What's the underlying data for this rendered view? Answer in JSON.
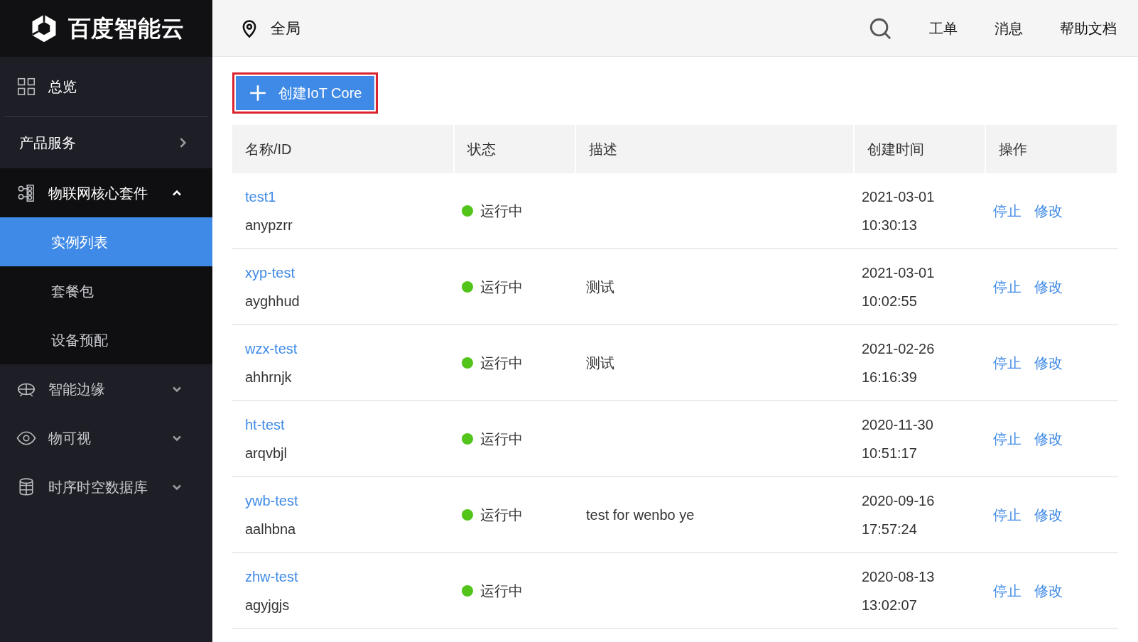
{
  "brand": {
    "name": "百度智能云"
  },
  "sidebar": {
    "items": [
      {
        "kind": "link",
        "label": "总览"
      },
      {
        "kind": "section",
        "label": "产品服务"
      },
      {
        "kind": "group",
        "label": "物联网核心套件",
        "expanded": true,
        "children": [
          {
            "label": "实例列表",
            "selected": true
          },
          {
            "label": "套餐包",
            "selected": false
          },
          {
            "label": "设备预配",
            "selected": false
          }
        ]
      },
      {
        "kind": "group",
        "label": "智能边缘",
        "expanded": false
      },
      {
        "kind": "group",
        "label": "物可视",
        "expanded": false
      },
      {
        "kind": "group",
        "label": "时序时空数据库",
        "expanded": false
      }
    ]
  },
  "header": {
    "region": "全局",
    "links": [
      "工单",
      "消息",
      "帮助文档"
    ]
  },
  "create_button": {
    "label": "创建IoT Core",
    "highlighted": true
  },
  "table": {
    "columns": [
      "名称/ID",
      "状态",
      "描述",
      "创建时间",
      "操作"
    ],
    "rows": [
      {
        "name": "test1",
        "id": "anypzrr",
        "status": "运行中",
        "date": "2021-03-01",
        "time": "10:30:13",
        "actions": [
          "停止",
          "修改"
        ]
      },
      {
        "name": "xyp-test",
        "id": "ayghhud",
        "status": "运行中",
        "description": "测试",
        "date": "2021-03-01",
        "time": "10:02:55",
        "actions": [
          "停止",
          "修改"
        ]
      },
      {
        "name": "wzx-test",
        "id": "ahhrnjk",
        "status": "运行中",
        "description": "测试",
        "date": "2021-02-26",
        "time": "16:16:39",
        "actions": [
          "停止",
          "修改"
        ]
      },
      {
        "name": "ht-test",
        "id": "arqvbjl",
        "status": "运行中",
        "date": "2020-11-30",
        "time": "10:51:17",
        "actions": [
          "停止",
          "修改"
        ]
      },
      {
        "name": "ywb-test",
        "id": "aalhbna",
        "status": "运行中",
        "description": "test for wenbo ye",
        "date": "2020-09-16",
        "time": "17:57:24",
        "actions": [
          "停止",
          "修改"
        ]
      },
      {
        "name": "zhw-test",
        "id": "agyjgjs",
        "status": "运行中",
        "date": "2020-08-13",
        "time": "13:02:07",
        "actions": [
          "停止",
          "修改"
        ]
      }
    ]
  }
}
